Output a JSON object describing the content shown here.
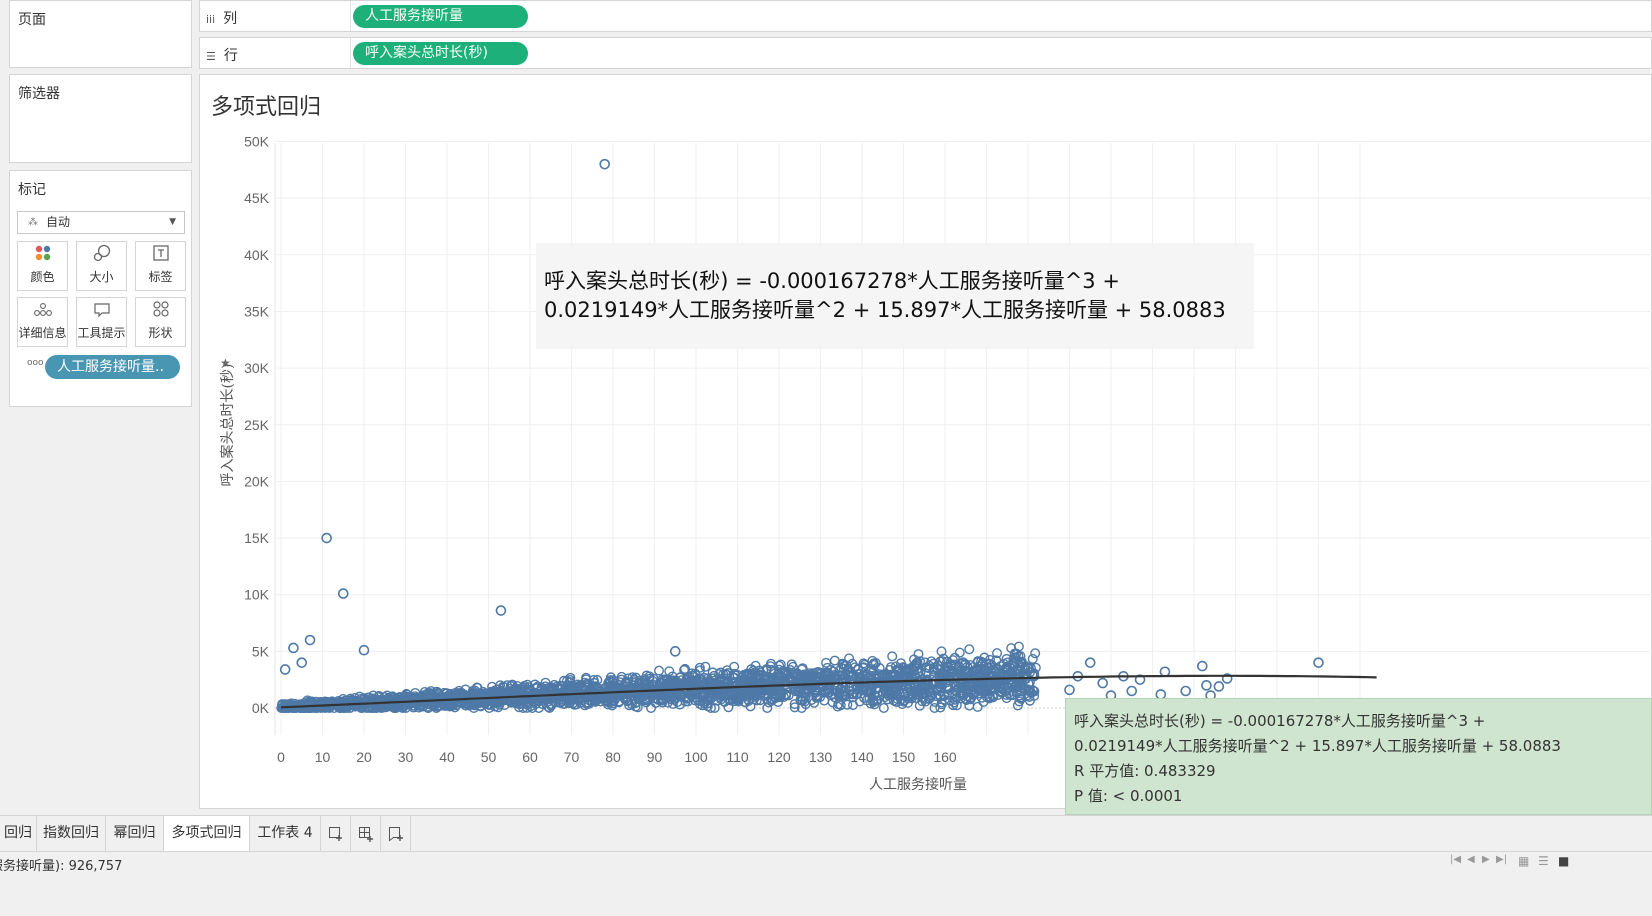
{
  "panels": {
    "pages": "页面",
    "filters": "筛选器",
    "marks": "标记",
    "mark_type": "自动",
    "mark_buttons": [
      "颜色",
      "大小",
      "标签",
      "详细信息",
      "工具提示",
      "形状"
    ],
    "marks_pill": "人工服务接听量.."
  },
  "shelves": {
    "columns_label": "列",
    "columns_pill": "人工服务接听量",
    "rows_label": "行",
    "rows_pill": "呼入案头总时长(秒)"
  },
  "view": {
    "title": "多项式回归",
    "equation_line1": "呼入案头总时长(秒) = -0.000167278*人工服务接听量^3 +",
    "equation_line2": "0.0219149*人工服务接听量^2 + 15.897*人工服务接听量 + 58.0883"
  },
  "tooltip": {
    "line1": "呼入案头总时长(秒) = -0.000167278*人工服务接听量^3 +",
    "line2": "0.0219149*人工服务接听量^2 + 15.897*人工服务接听量 + 58.0883",
    "line3": "R 平方值: 0.483329",
    "line4": "P 值: < 0.0001"
  },
  "tabs": [
    "回归",
    "指数回归",
    "幂回归",
    "多项式回归",
    "工作表 4"
  ],
  "active_tab": "多项式回归",
  "status": "服务接听量): 926,757",
  "colors": {
    "point": "#4e79a7",
    "trend": "#333333",
    "pill_green": "#1eb07a",
    "pill_blue": "#4996b2",
    "tooltip_bg": "#cfe5cf"
  },
  "chart_data": {
    "type": "scatter",
    "xlabel": "人工服务接听量",
    "ylabel": "呼入案头总时长(秒)",
    "x_ticks": [
      "0",
      "10",
      "20",
      "30",
      "40",
      "50",
      "60",
      "70",
      "80",
      "90",
      "100",
      "110",
      "120",
      "130",
      "140",
      "150",
      "160"
    ],
    "y_ticks": [
      "0K",
      "5K",
      "10K",
      "15K",
      "20K",
      "25K",
      "30K",
      "35K",
      "40K",
      "45K",
      "50K"
    ],
    "xlim": [
      0,
      270
    ],
    "ylim": [
      -2500,
      52000
    ],
    "trend": {
      "a3": -0.000167278,
      "a2": 0.0219149,
      "a1": 15.897,
      "a0": 58.0883
    },
    "outliers": [
      {
        "x": 78,
        "y": 48000
      },
      {
        "x": 11,
        "y": 15000
      },
      {
        "x": 15,
        "y": 10100
      },
      {
        "x": 53,
        "y": 8600
      },
      {
        "x": 7,
        "y": 6000
      },
      {
        "x": 3,
        "y": 5300
      },
      {
        "x": 20,
        "y": 5100
      },
      {
        "x": 95,
        "y": 5000
      },
      {
        "x": 1,
        "y": 3400
      },
      {
        "x": 5,
        "y": 4000
      },
      {
        "x": 250,
        "y": 4000
      },
      {
        "x": 222,
        "y": 3700
      },
      {
        "x": 195,
        "y": 4000
      },
      {
        "x": 213,
        "y": 3200
      },
      {
        "x": 228,
        "y": 2600
      },
      {
        "x": 207,
        "y": 2500
      },
      {
        "x": 205,
        "y": 1500
      },
      {
        "x": 223,
        "y": 2000
      },
      {
        "x": 224,
        "y": 1100
      },
      {
        "x": 226,
        "y": 1900
      },
      {
        "x": 218,
        "y": 1500
      },
      {
        "x": 212,
        "y": 1200
      },
      {
        "x": 200,
        "y": 1100
      },
      {
        "x": 198,
        "y": 2200
      },
      {
        "x": 203,
        "y": 2800
      },
      {
        "x": 190,
        "y": 1600
      },
      {
        "x": 192,
        "y": 2800
      }
    ]
  }
}
